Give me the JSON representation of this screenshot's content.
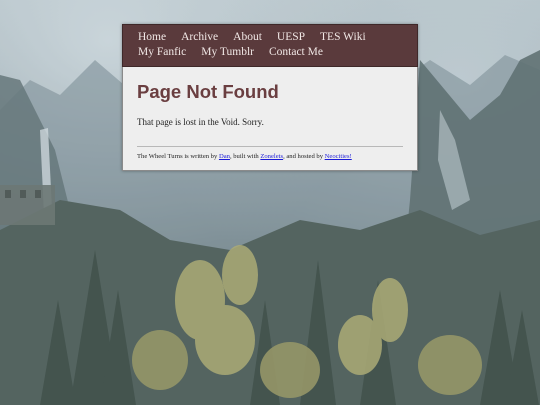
{
  "nav": {
    "row1": [
      "Home",
      "Archive",
      "About",
      "UESP",
      "TES Wiki"
    ],
    "row2": [
      "My Fanfic",
      "My Tumblr",
      "Contact Me"
    ]
  },
  "page": {
    "title": "Page Not Found",
    "message": "That page is lost in the Void. Sorry."
  },
  "footer": {
    "text1": "The Wheel Turns is written by ",
    "link_author": "Dan",
    "text2": ", built with ",
    "link_builder": "Zonelets",
    "text3": ", and hosted by ",
    "link_host": "Neocities!"
  },
  "colors": {
    "nav_background": "#5a3a3c",
    "title": "#6a3e40",
    "link": "#1a1ad8",
    "content_background": "#eeeeee"
  }
}
